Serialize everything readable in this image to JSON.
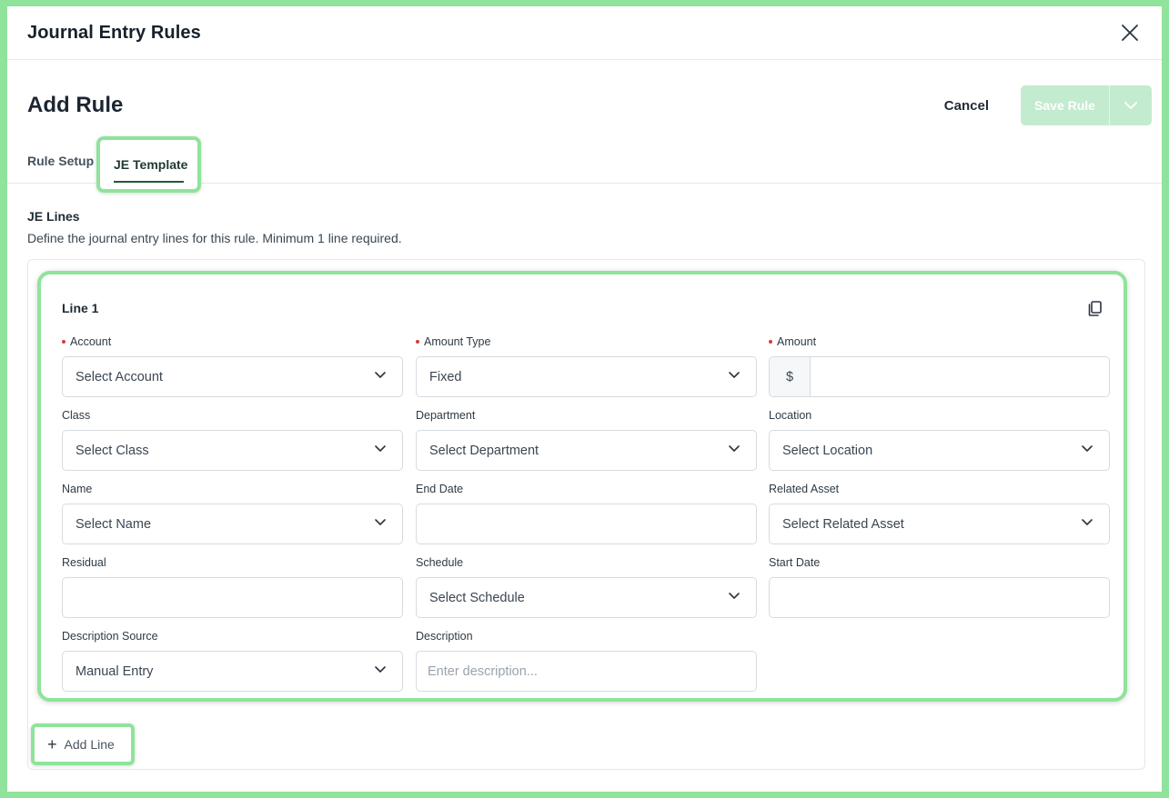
{
  "modal": {
    "title": "Journal Entry Rules"
  },
  "page": {
    "title": "Add Rule"
  },
  "actions": {
    "cancel": "Cancel",
    "save": "Save Rule"
  },
  "tabs": [
    {
      "label": "Rule Setup"
    },
    {
      "label": "JE Template"
    }
  ],
  "section": {
    "title": "JE Lines",
    "description": "Define the journal entry lines for this rule. Minimum 1 line required."
  },
  "line": {
    "title": "Line 1",
    "fields": {
      "account": {
        "label": "Account",
        "value": "Select Account"
      },
      "amount_type": {
        "label": "Amount Type",
        "value": "Fixed"
      },
      "amount": {
        "label": "Amount",
        "prefix": "$",
        "value": ""
      },
      "class": {
        "label": "Class",
        "value": "Select Class"
      },
      "department": {
        "label": "Department",
        "value": "Select Department"
      },
      "location": {
        "label": "Location",
        "value": "Select Location"
      },
      "name": {
        "label": "Name",
        "value": "Select Name"
      },
      "end_date": {
        "label": "End Date",
        "value": ""
      },
      "related_asset": {
        "label": "Related Asset",
        "value": "Select Related Asset"
      },
      "residual": {
        "label": "Residual",
        "value": ""
      },
      "schedule": {
        "label": "Schedule",
        "value": "Select Schedule"
      },
      "start_date": {
        "label": "Start Date",
        "value": ""
      },
      "description_source": {
        "label": "Description Source",
        "value": "Manual Entry"
      },
      "description": {
        "label": "Description",
        "placeholder": "Enter description..."
      }
    }
  },
  "add_line": {
    "label": "Add Line"
  },
  "colors": {
    "highlight": "#8fe39a",
    "save_disabled": "#c3ebcf",
    "required": "#d93a3a",
    "tab_active": "#1f5a3c"
  }
}
